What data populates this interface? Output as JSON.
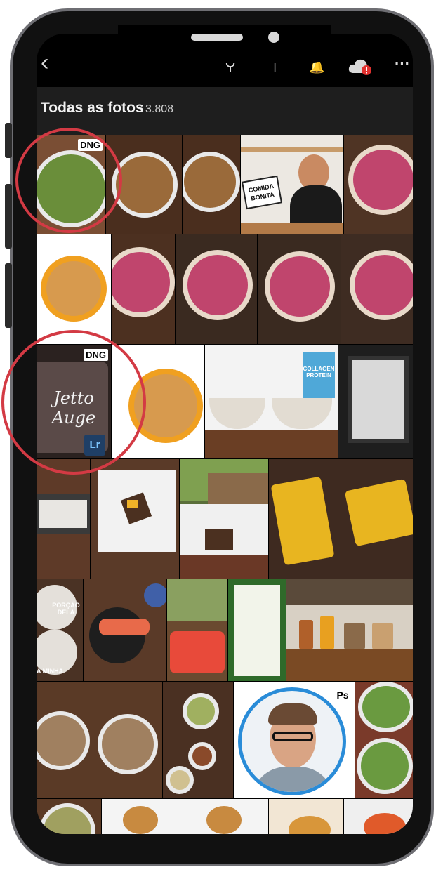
{
  "header": {
    "title": "Todas as fotos",
    "photo_count": "3.808"
  },
  "toolbar": {
    "back_icon": "‹",
    "search_icon": "⚲",
    "filter_icon": "⊤",
    "bell_icon": "🔔",
    "cloud_icon": "cloud-alert",
    "more_icon": "···"
  },
  "badges": {
    "dng_1": "DNG",
    "dng_2": "DNG",
    "lr": "Lr",
    "ps": "Ps"
  },
  "photos": {
    "sign_text": "COMIDA BONITA",
    "mug_text": "Jetto Auge",
    "porcao_text": "PORÇÃO DELA",
    "minha_text": "A MINHA",
    "collagen_text": "COLLAGEN PROTEIN"
  },
  "colors": {
    "accent_red": "#d33a44",
    "background": "#000000",
    "lr_blue": "#1f3f66"
  }
}
